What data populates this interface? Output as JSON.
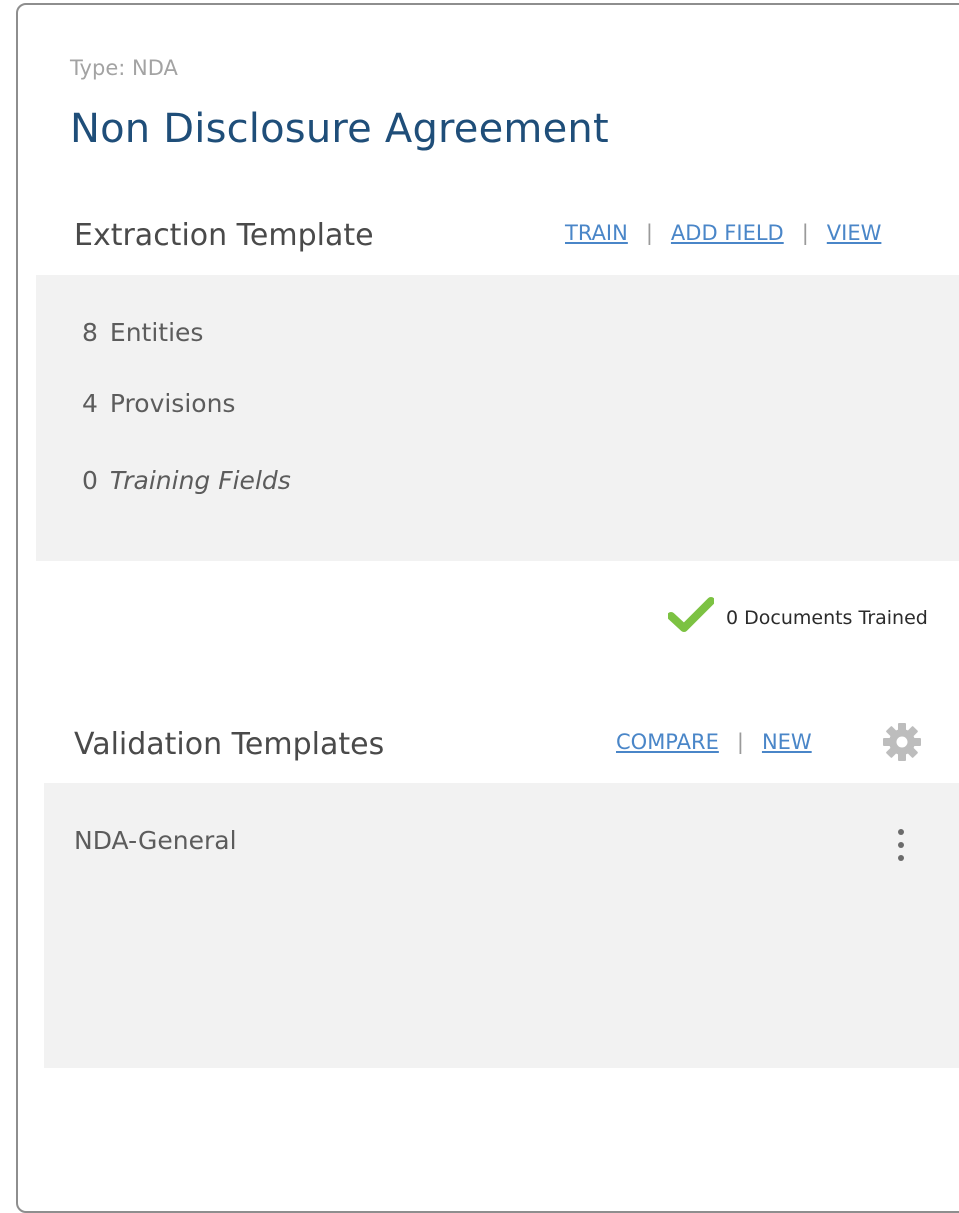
{
  "header": {
    "type_label": "Type: NDA",
    "title": "Non Disclosure Agreement"
  },
  "extraction": {
    "title": "Extraction Template",
    "actions": {
      "train": "TRAIN",
      "add_field": "ADD FIELD",
      "view": "VIEW",
      "separator": "|"
    },
    "counts": [
      {
        "value": "8",
        "label": "Entities"
      },
      {
        "value": "4",
        "label": "Provisions"
      },
      {
        "value": "0",
        "label": "Training Fields"
      }
    ],
    "status": {
      "icon": "checkmark-icon",
      "text": "0 Documents Trained",
      "color": "#7cc242"
    }
  },
  "validation": {
    "title": "Validation Templates",
    "actions": {
      "compare": "COMPARE",
      "new": "NEW",
      "separator": "|"
    },
    "settings_icon": "gear-icon",
    "templates": [
      {
        "name": "NDA-General",
        "menu_icon": "kebab-menu-icon"
      }
    ]
  },
  "colors": {
    "title": "#1f4e79",
    "link": "#4a86c8",
    "panel": "#f2f2f2",
    "check": "#7cc242",
    "gear": "#bdbdbd"
  }
}
